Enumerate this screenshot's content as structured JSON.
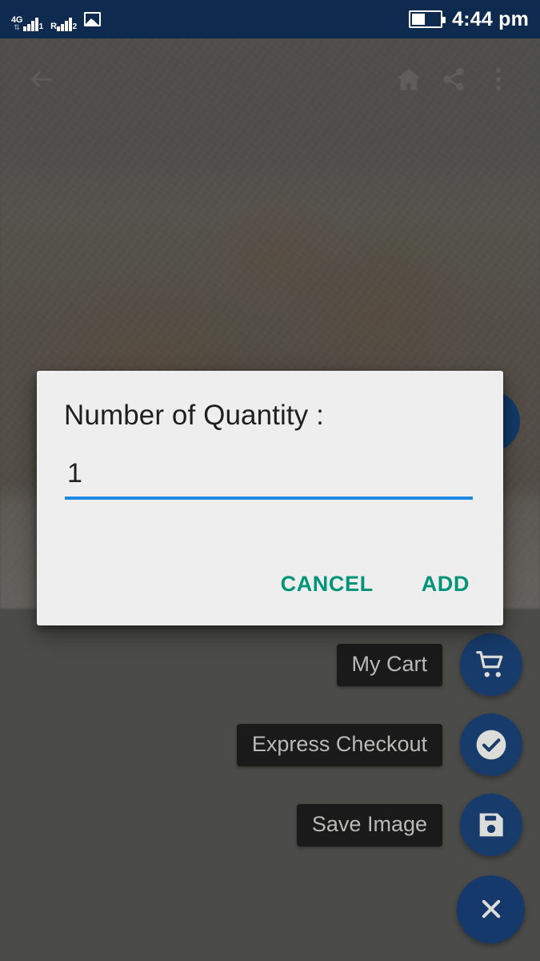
{
  "status_bar": {
    "network_tag": "4G",
    "data_arrows": "⇅",
    "sim1_label": "1",
    "roaming_tag": "R",
    "sim2_label": "2",
    "gallery_icon": "image-icon",
    "battery_icon": "battery-half-icon",
    "time": "4:44 pm",
    "background_color": "#0e2a4e"
  },
  "app_bar": {
    "back_icon": "arrow-back-icon",
    "home_icon": "home-icon",
    "share_icon": "share-icon",
    "overflow_icon": "more-vertical-icon"
  },
  "dialog": {
    "title": "Number of Quantity :",
    "input": {
      "value": "1",
      "placeholder": "",
      "underline_color": "#1e88e5"
    },
    "cancel_label": "CANCEL",
    "add_label": "ADD",
    "action_color": "#009478",
    "background_color": "#eeeeee"
  },
  "fab_menu": {
    "accent_color": "#173c6b",
    "items": [
      {
        "label": "My Cart",
        "icon": "shopping-cart-icon"
      },
      {
        "label": "Express Checkout",
        "icon": "check-circle-icon"
      },
      {
        "label": "Save Image",
        "icon": "save-floppy-icon"
      }
    ],
    "main": {
      "icon": "close-x-icon",
      "label": ""
    }
  }
}
